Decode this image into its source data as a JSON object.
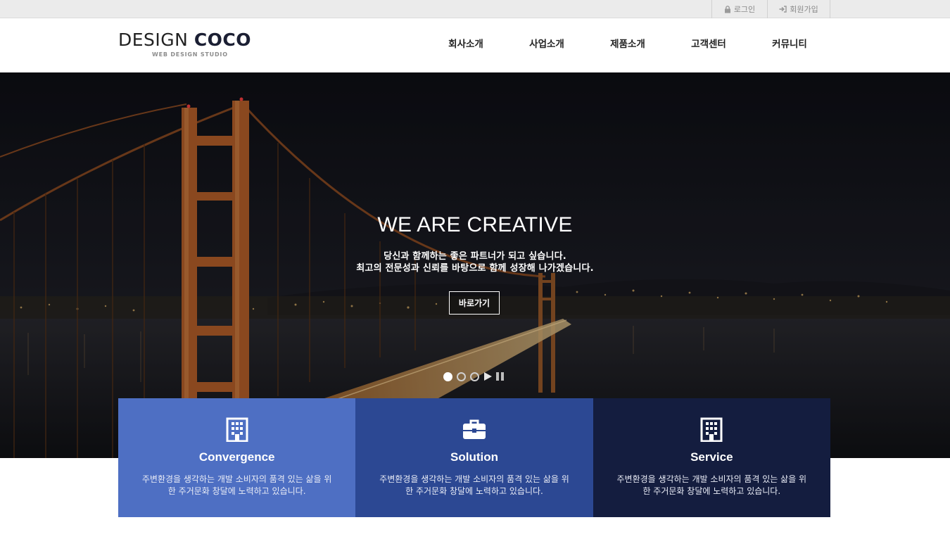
{
  "util_nav": {
    "login": {
      "label": "로그인",
      "icon": "lock-icon"
    },
    "join": {
      "label": "회원가입",
      "icon": "sign-in-icon"
    }
  },
  "logo": {
    "main_thin": "DESIGN",
    "main_bold": "COCO",
    "subtitle": "WEB DESIGN STUDIO"
  },
  "gnb": {
    "items": [
      {
        "label": "회사소개"
      },
      {
        "label": "사업소개"
      },
      {
        "label": "제품소개"
      },
      {
        "label": "고객센터"
      },
      {
        "label": "커뮤니티"
      }
    ]
  },
  "hero": {
    "title": "WE ARE CREATIVE",
    "line1": "당신과 함께하는 좋은 파트너가 되고 싶습니다.",
    "line2": "최고의 전문성과 신뢰를 바탕으로 함께 성장해 나가겠습니다.",
    "button_label": "바로가기",
    "slider": {
      "total_slides": 3,
      "active_index": 0
    }
  },
  "features": [
    {
      "title": "Convergence",
      "icon": "building-icon",
      "color": "#4e6fc3",
      "desc_line1": "주변환경을 생각하는 개발 소비자의 품격 있는 삶을 위",
      "desc_line2": "한 주거문화 창달에 노력하고 있습니다."
    },
    {
      "title": "Solution",
      "icon": "briefcase-icon",
      "color": "#2c4893",
      "desc_line1": "주변환경을 생각하는 개발 소비자의 품격 있는 삶을 위",
      "desc_line2": "한 주거문화 창달에 노력하고 있습니다."
    },
    {
      "title": "Service",
      "icon": "building-icon",
      "color": "#141d3f",
      "desc_line1": "주변환경을 생각하는 개발 소비자의 품격 있는 삶을 위",
      "desc_line2": "한 주거문화 창달에 노력하고 있습니다."
    }
  ],
  "colors": {
    "topbar_bg": "#ebebeb",
    "hero_dark": "#0f0f14",
    "bridge_orange": "#c8612a"
  }
}
